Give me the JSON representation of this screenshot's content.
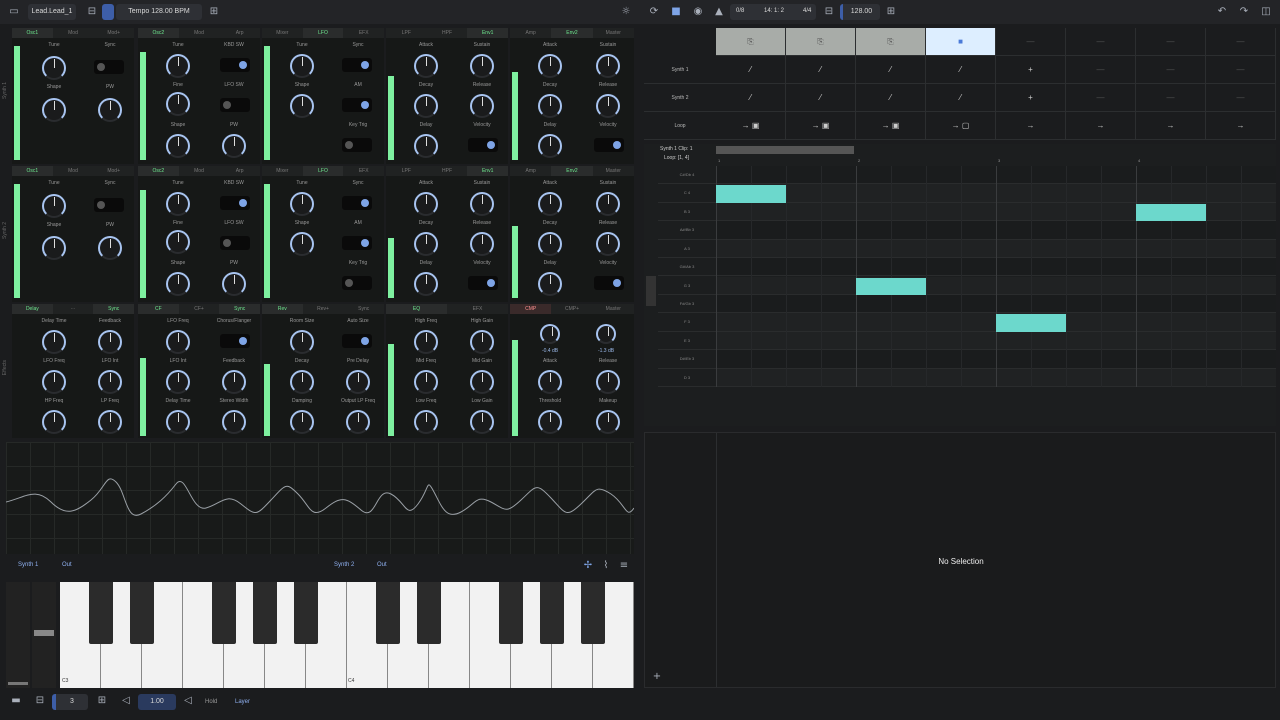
{
  "topbar": {
    "preset": "Lead.Lead_1",
    "tempo": "Tempo 128.00 BPM",
    "counter": "0/8",
    "position": "14: 1: 2",
    "meter": "4/4",
    "bpm": "128.00"
  },
  "synth1": {
    "side": "Synth 1",
    "tabs_a": [
      "Osc1",
      "Mod",
      "Mod+"
    ],
    "tabs_b": [
      "Osc2",
      "Mod",
      "Arp"
    ],
    "tabs_c": [
      "Mixer",
      "LFO",
      "EFX"
    ],
    "tabs_d": [
      "LPF",
      "HPF",
      "Env1"
    ],
    "tabs_e": [
      "Amp",
      "Env2",
      "Master"
    ],
    "labels_a": [
      "Tune",
      "Sync",
      "Shape",
      "PW"
    ],
    "labels_b": [
      "Tune",
      "KBD SW",
      "Fine",
      "LFO SW",
      "Shape",
      "PW"
    ],
    "labels_c": [
      "Tune",
      "Sync",
      "Shape",
      "AM",
      "Key Trig"
    ],
    "labels_d": [
      "Attack",
      "Sustain",
      "Decay",
      "Release",
      "Delay",
      "Velocity"
    ],
    "labels_e": [
      "Attack",
      "Sustain",
      "Decay",
      "Release",
      "Delay",
      "Velocity"
    ]
  },
  "synth2": {
    "side": "Synth 2",
    "tabs_a": [
      "Osc1",
      "Mod",
      "Mod+"
    ],
    "tabs_b": [
      "Osc2",
      "Mod",
      "Arp"
    ],
    "tabs_c": [
      "Mixer",
      "LFO",
      "EFX"
    ],
    "tabs_d": [
      "LPF",
      "HPF",
      "Env1"
    ],
    "tabs_e": [
      "Amp",
      "Env2",
      "Master"
    ],
    "labels_a": [
      "Tune",
      "Sync",
      "Shape",
      "PW"
    ],
    "labels_b": [
      "Tune",
      "KBD SW",
      "Fine",
      "LFO SW",
      "Shape",
      "PW"
    ],
    "labels_c": [
      "Tune",
      "Sync",
      "Shape",
      "AM",
      "Key Trig"
    ],
    "labels_d": [
      "Attack",
      "Sustain",
      "Decay",
      "Release",
      "Delay",
      "Velocity"
    ],
    "labels_e": [
      "Attack",
      "Sustain",
      "Decay",
      "Release",
      "Delay",
      "Velocity"
    ]
  },
  "effects": {
    "side": "Effects",
    "tabs_a": [
      "Delay",
      "···",
      "Sync"
    ],
    "tabs_b": [
      "CF",
      "CF+",
      "Sync"
    ],
    "tabs_c": [
      "Rev",
      "Rev+",
      "Sync"
    ],
    "tabs_d": [
      "EQ",
      "EFX"
    ],
    "tabs_e": [
      "CMP",
      "CMP+",
      "Master"
    ],
    "labels_a": [
      "Delay Time",
      "Feedback",
      "LFO Freq",
      "LFO Int",
      "HP Freq",
      "LP Freq"
    ],
    "labels_b": [
      "LFO Freq",
      "Chorus/Flanger",
      "LFO Int",
      "Feedback",
      "Delay Time",
      "Stereo Width"
    ],
    "labels_c": [
      "Room Size",
      "Auto Size",
      "Decay",
      "Pre Delay",
      "Damping",
      "Output LP Freq"
    ],
    "labels_d": [
      "High Freq",
      "High Gain",
      "Mid Freq",
      "Mid Gain",
      "Low Freq",
      "Low Gain"
    ],
    "labels_e": [
      "Attack",
      "Release",
      "Threshold",
      "Makeup"
    ],
    "cmp_vals": [
      "-0.4 dB",
      "-1.3 dB"
    ]
  },
  "keyboard": {
    "left_track": "Synth 1",
    "left_out": "Out",
    "right_track": "Synth 2",
    "right_out": "Out",
    "c3": "C3",
    "c4": "C4"
  },
  "bottombar": {
    "octave": "3",
    "velocity": "1.00",
    "hold": "Hold",
    "layer": "Layer"
  },
  "clipgrid": {
    "rows": [
      "Synth 1",
      "Synth 2",
      "Loop"
    ],
    "empty": "—"
  },
  "pianoroll": {
    "title": "Synth 1 Clip: 1",
    "loop": "Loop: [1, 4]",
    "bars": [
      "1",
      "2",
      "3",
      "4"
    ],
    "keys": [
      "C#/Db 4",
      "C 4",
      "B 3",
      "A#/Bb 3",
      "A 3",
      "G#/Ab 3",
      "G 3",
      "F#/Gb 3",
      "F 3",
      "E 3",
      "D#/Eb 3",
      "D 3"
    ],
    "notes": [
      {
        "pitch": "C 4",
        "start": 1.0,
        "length": 0.5
      },
      {
        "pitch": "G 3",
        "start": 2.0,
        "length": 0.5
      },
      {
        "pitch": "F 3",
        "start": 3.0,
        "length": 0.5
      },
      {
        "pitch": "B 3",
        "start": 4.0,
        "length": 0.5
      }
    ]
  },
  "inspector": {
    "empty": "No Selection"
  },
  "colors": {
    "accent_green": "#7ef0a0",
    "accent_blue": "#7ea4e6",
    "note": "#6cd8cc"
  }
}
